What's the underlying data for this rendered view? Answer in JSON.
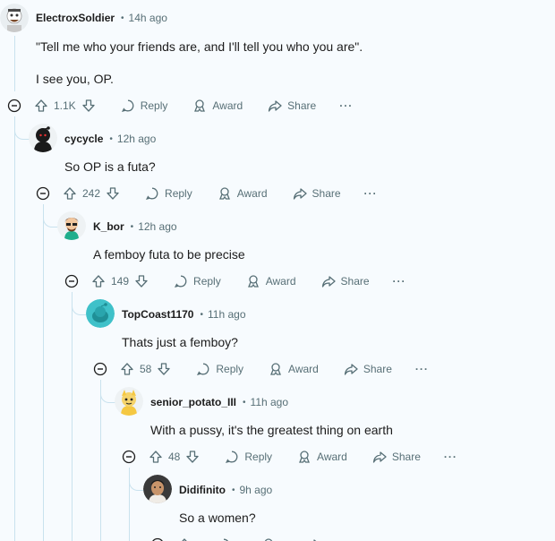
{
  "comments": [
    {
      "author": "ElectroxSoldier",
      "time": "14h ago",
      "lines": [
        "\"Tell me who your friends are, and I'll tell you who you are\".",
        "I see you, OP."
      ],
      "score": "1.1K"
    },
    {
      "author": "cycycle",
      "time": "12h ago",
      "lines": [
        "So OP is a futa?"
      ],
      "score": "242"
    },
    {
      "author": "K_bor",
      "time": "12h ago",
      "lines": [
        "A femboy futa to be precise"
      ],
      "score": "149"
    },
    {
      "author": "TopCoast1170",
      "time": "11h ago",
      "lines": [
        "Thats just a femboy?"
      ],
      "score": "58"
    },
    {
      "author": "senior_potato_III",
      "time": "11h ago",
      "lines": [
        "With a pussy, it's the greatest thing on earth"
      ],
      "score": "48"
    },
    {
      "author": "Didifinito",
      "time": "9h ago",
      "lines": [
        "So a women?"
      ],
      "score": ""
    }
  ],
  "actions": {
    "reply": "Reply",
    "award": "Award",
    "share": "Share",
    "more": "···"
  },
  "colors": {
    "background": "#f7fbfe",
    "thread_line": "#c9e2ee",
    "meta_gray": "#576f76"
  }
}
